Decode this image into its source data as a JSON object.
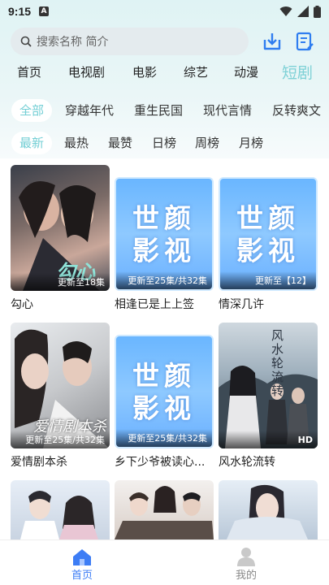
{
  "status_bar": {
    "time": "9:15",
    "notif_badge": "A"
  },
  "search": {
    "placeholder": "搜索名称 简介"
  },
  "main_tabs": [
    "首页",
    "电视剧",
    "电影",
    "综艺",
    "动漫",
    "短剧"
  ],
  "main_tab_active": "短剧",
  "category_chips": [
    "全部",
    "穿越年代",
    "重生民国",
    "现代言情",
    "反转爽文"
  ],
  "sort_chips": [
    "最新",
    "最热",
    "最赞",
    "日榜",
    "周榜",
    "月榜"
  ],
  "brand_poster_text": [
    "世颜",
    "影视"
  ],
  "items": [
    {
      "title": "勾心",
      "badge": "更新至18集"
    },
    {
      "title": "相逢已是上上签",
      "badge": "更新至25集/共32集"
    },
    {
      "title": "情深几许",
      "badge": "更新至【12】"
    },
    {
      "title": "爱情剧本杀",
      "badge": "更新至25集/共32集"
    },
    {
      "title": "乡下少爷被读心...",
      "badge": "更新至25集/共32集"
    },
    {
      "title": "风水轮流转",
      "badge": "HD"
    }
  ],
  "poster_overlay_text": {
    "item1": "勾心",
    "item4": "爱情剧本杀",
    "item6": "风水轮流转"
  },
  "bottom_nav": {
    "home_label": "首页",
    "mine_label": "我的"
  },
  "colors": {
    "accent": "#74cfd5",
    "brand_poster": "#6ab6ff"
  }
}
